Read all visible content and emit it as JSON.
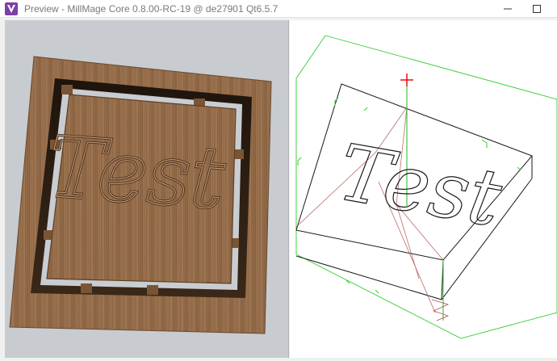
{
  "window": {
    "title": "Preview - MillMage Core 0.8.00-RC-19 @ de27901 Qt6.5.7",
    "minimize_icon": "minimize-icon",
    "maximize_icon": "maximize-icon",
    "app_icon": "millmage-logo-icon"
  },
  "preview_3d": {
    "engraved_text": "Test",
    "material": "walnut-wood"
  },
  "wireframe": {
    "path_text": "Test",
    "colors": {
      "stock_outline": "#1a1a1a",
      "bounds": "#33cc33",
      "rapid_moves": "#b05050",
      "origin_marker": "#e00000",
      "z_axis": "#22bb22"
    }
  }
}
